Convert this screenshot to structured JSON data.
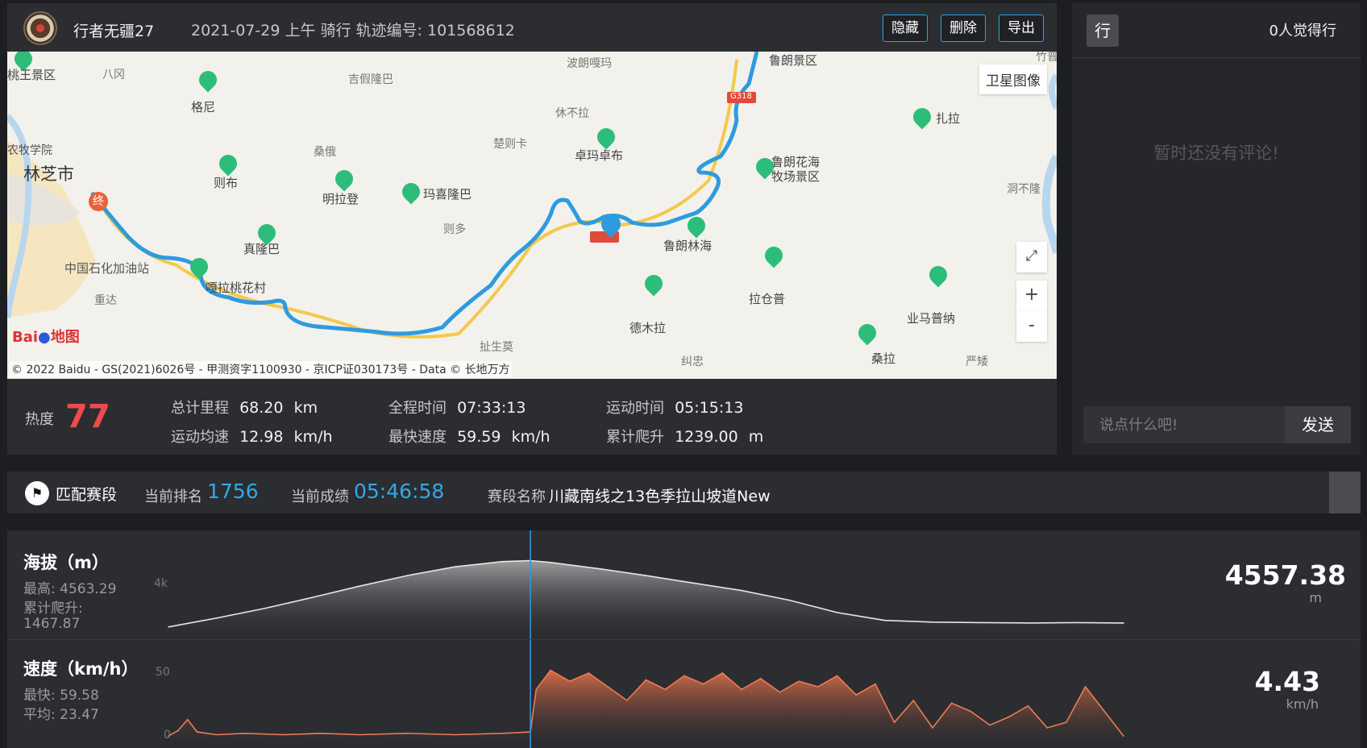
{
  "header": {
    "username": "行者无疆27",
    "ride_info": "2021-07-29 上午 骑行  轨迹编号: 101568612",
    "buttons": {
      "hide": "隐藏",
      "delete": "删除",
      "export": "导出"
    }
  },
  "map": {
    "satellite_label": "卫星图像",
    "zoom_in": "+",
    "zoom_out": "-",
    "copyright": "© 2022 Baidu - GS(2021)6026号 - 甲测资字1100930 - 京ICP证030173号 - Data © 长地万方",
    "logo_text": "Bai",
    "logo_text2": "地图",
    "end_marker": "终",
    "labels": {
      "l1": "桃王景区",
      "l2": "八冈",
      "l3": "吉假隆巴",
      "l4": "波朗嘎玛",
      "l5": "鲁朗景区",
      "l6": "竹普",
      "l7": "格尼",
      "l8": "休不拉",
      "l9": "扎拉",
      "l10": "农牧学院",
      "l11": "林芝市",
      "l12": "桑俄",
      "l13": "楚则卡",
      "l14": "卓玛卓布",
      "l15": "鲁朗花海",
      "l16": "牧场景区",
      "l17": "则布",
      "l18": "明拉登",
      "l19": "玛喜隆巴",
      "l20": "洞不隆",
      "l21": "则多",
      "l22": "鲁朗林海",
      "l23": "真隆巴",
      "l24": "中国石化加油站",
      "l25": "嘎拉桃花村",
      "l26": "拉仓普",
      "l27": "重达",
      "l28": "德木拉",
      "l29": "业马普纳",
      "l30": "扯生莫",
      "l31": "纠忠",
      "l32": "桑拉",
      "l33": "严矮",
      "l34": "G318"
    }
  },
  "stats": {
    "heat_label": "热度",
    "heat_value": "77",
    "items": [
      {
        "label": "总计里程",
        "value": "68.20",
        "unit": "km"
      },
      {
        "label": "运动均速",
        "value": "12.98",
        "unit": "km/h"
      },
      {
        "label": "全程时间",
        "value": "07:33:13",
        "unit": ""
      },
      {
        "label": "最快速度",
        "value": "59.59",
        "unit": "km/h"
      },
      {
        "label": "运动时间",
        "value": "05:15:13",
        "unit": ""
      },
      {
        "label": "累计爬升",
        "value": "1239.00",
        "unit": "m"
      }
    ]
  },
  "comments": {
    "icon": "行",
    "likes": "0人觉得行",
    "empty": "暂时还没有评论!",
    "placeholder": "说点什么吧!",
    "send": "发送"
  },
  "segment": {
    "title": "匹配赛段",
    "rank_label": "当前排名",
    "rank_value": "1756",
    "result_label": "当前成绩",
    "result_value": "05:46:58",
    "name_label": "赛段名称",
    "name_value": "川藏南线之13色季拉山坡道New"
  },
  "charts": {
    "altitude": {
      "title": "海拔（m）",
      "max_line": "最高: 4563.29",
      "climb_line1": "累计爬升:",
      "climb_line2": "1467.87",
      "tick": "4k",
      "current_value": "4557.38",
      "unit": "m"
    },
    "speed": {
      "title": "速度（km/h）",
      "max_line": "最快: 59.58",
      "avg_line": "平均: 23.47",
      "tick_top": "50",
      "tick_bottom": "0",
      "current_value": "4.43",
      "unit": "km/h"
    }
  },
  "chart_data": [
    {
      "type": "area",
      "title": "海拔（m）",
      "ylabel": "m",
      "yticks": [
        "4k"
      ],
      "ylim": [
        2900,
        4700
      ],
      "x": [
        0,
        5,
        10,
        15,
        20,
        25,
        30,
        35,
        37.9,
        40,
        45,
        50,
        55,
        60,
        65,
        70,
        75,
        80,
        85,
        90,
        95,
        100
      ],
      "values": [
        3050,
        3250,
        3470,
        3720,
        3980,
        4220,
        4420,
        4540,
        4563,
        4520,
        4380,
        4220,
        4050,
        3880,
        3660,
        3380,
        3200,
        3160,
        3150,
        3140,
        3150,
        3140
      ],
      "cursor_x": 37.9
    },
    {
      "type": "area",
      "title": "速度（km/h）",
      "ylabel": "km/h",
      "yticks": [
        "50",
        "0"
      ],
      "ylim": [
        0,
        60
      ],
      "x": [
        0,
        1,
        2,
        3,
        5,
        8,
        12,
        16,
        20,
        25,
        30,
        35,
        37.9,
        38.5,
        40,
        42,
        44,
        46,
        48,
        50,
        52,
        54,
        56,
        58,
        60,
        62,
        64,
        66,
        68,
        70,
        72,
        74,
        76,
        78,
        80,
        82,
        84,
        86,
        88,
        90,
        92,
        94,
        96,
        98,
        100
      ],
      "values": [
        4,
        8,
        16,
        7,
        5,
        6,
        5,
        6,
        5,
        6,
        5,
        6,
        7,
        38,
        52,
        44,
        50,
        40,
        30,
        45,
        38,
        48,
        42,
        50,
        38,
        46,
        36,
        44,
        40,
        48,
        34,
        42,
        14,
        30,
        10,
        28,
        22,
        12,
        18,
        26,
        10,
        14,
        40,
        22,
        4
      ],
      "cursor_x": 37.9
    }
  ]
}
